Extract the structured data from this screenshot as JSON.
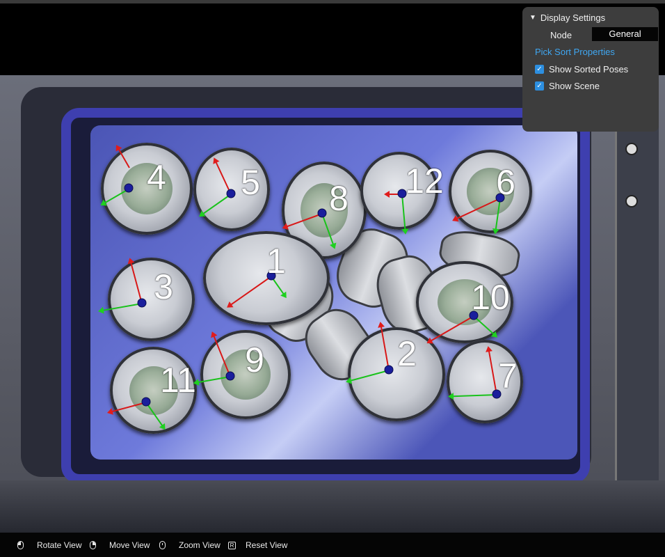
{
  "settings": {
    "title": "Display Settings",
    "node_label": "Node",
    "node_value": "General",
    "link": "Pick Sort Properties",
    "show_sorted_poses": {
      "label": "Show Sorted Poses",
      "checked": true
    },
    "show_scene": {
      "label": "Show Scene",
      "checked": true
    }
  },
  "poses": [
    {
      "label": "4"
    },
    {
      "label": "5"
    },
    {
      "label": "8"
    },
    {
      "label": "12"
    },
    {
      "label": "6"
    },
    {
      "label": "1"
    },
    {
      "label": "3"
    },
    {
      "label": "10"
    },
    {
      "label": "9"
    },
    {
      "label": "2"
    },
    {
      "label": "11"
    },
    {
      "label": "7"
    }
  ],
  "toolbar": {
    "rotate": {
      "icon": "mouse-left-icon",
      "label": "Rotate View"
    },
    "move": {
      "icon": "mouse-right-icon",
      "label": "Move View"
    },
    "zoom": {
      "icon": "mouse-wheel-icon",
      "label": "Zoom View"
    },
    "reset": {
      "icon": "r-key-icon",
      "key": "R",
      "label": "Reset View"
    }
  },
  "colors": {
    "panel_bg": "#3d3d3d",
    "link": "#3fa7f2",
    "checkbox": "#2d8fe0",
    "axis_x": "#d81818",
    "axis_y": "#19c21b",
    "pose_center": "#1a1e9c",
    "tray": "#3e3faf"
  }
}
